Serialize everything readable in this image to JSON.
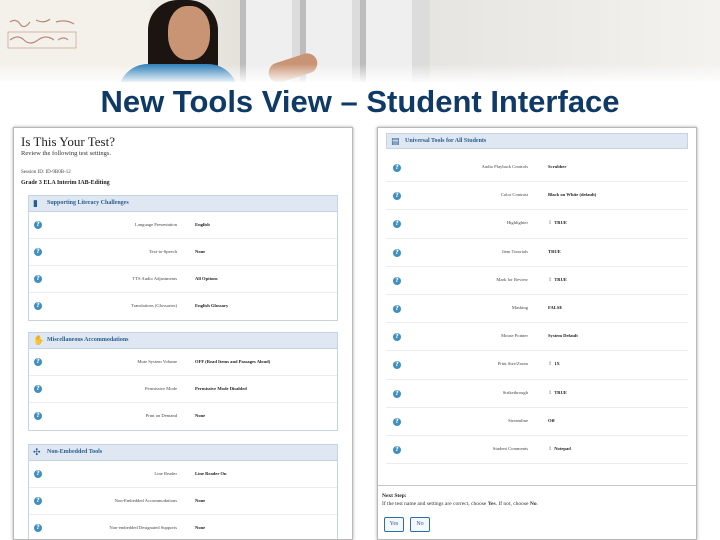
{
  "slide_title": "New Tools View – Student Interface",
  "left": {
    "title": "Is This Your Test?",
    "subtitle": "Review the following test settings.",
    "session_id": "Session ID: ID-9B0B-12",
    "test_name": "Grade 3 ELA Interim IAB-Editing",
    "sections": [
      {
        "title": "Supporting Literacy Challenges",
        "rows": [
          {
            "label": "Language Presentation",
            "value": "English"
          },
          {
            "label": "Text-to-Speech",
            "value": "None"
          },
          {
            "label": "TTS Audio Adjustments",
            "value": "All Options"
          },
          {
            "label": "Translations (Glossaries)",
            "value": "English Glossary"
          }
        ]
      },
      {
        "title": "Miscellaneous Accommodations",
        "rows": [
          {
            "label": "Mute System Volume",
            "value": "OFF (Read Items and Passages Aloud)"
          },
          {
            "label": "Permissive Mode",
            "value": "Permissive Mode Disabled"
          },
          {
            "label": "Print on Demand",
            "value": "None"
          }
        ]
      },
      {
        "title": "Non-Embedded Tools",
        "rows": [
          {
            "label": "Line Reader",
            "value": "Line Reader On"
          },
          {
            "label": "Non-Embedded Accommodations",
            "value": "None"
          },
          {
            "label": "Non-embedded Designated Supports",
            "value": "None"
          }
        ]
      }
    ]
  },
  "right": {
    "section_title": "Universal Tools for All Students",
    "rows": [
      {
        "label": "Audio Playback Controls",
        "value": "Scrubber"
      },
      {
        "label": "Color Contrast",
        "value": "Black on White (default)"
      },
      {
        "label": "Highlighter",
        "value": "TRUE"
      },
      {
        "label": "Item Tutorials",
        "value": "TRUE"
      },
      {
        "label": "Mark for Review",
        "value": "TRUE"
      },
      {
        "label": "Masking",
        "value": "FALSE"
      },
      {
        "label": "Mouse Pointer",
        "value": "System Default"
      },
      {
        "label": "Print Size/Zoom",
        "value": "1X"
      },
      {
        "label": "Strikethrough",
        "value": "TRUE"
      },
      {
        "label": "Streamline",
        "value": "Off"
      },
      {
        "label": "Student Comments",
        "value": "Notepad"
      }
    ],
    "next_step_title": "Next Step:",
    "next_step_text_pre": "If the test name and settings are correct, choose ",
    "next_step_yes_word": "Yes",
    "next_step_text_mid": ". If not, choose ",
    "next_step_no_word": "No",
    "next_step_text_end": ".",
    "yes_button": "Yes",
    "no_button": "No"
  }
}
